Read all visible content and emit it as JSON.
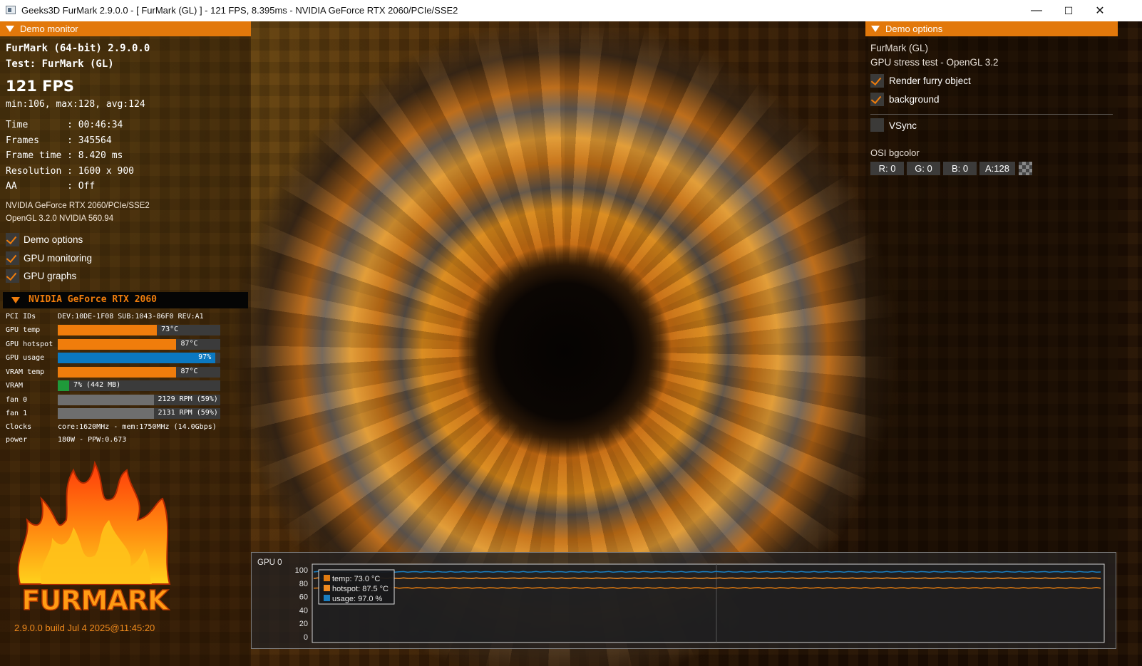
{
  "window": {
    "title": "Geeks3D FurMark 2.9.0.0 - [ FurMark (GL) ] - 121 FPS, 8.395ms - NVIDIA GeForce RTX 2060/PCIe/SSE2",
    "minimize": "—",
    "maximize": "☐",
    "close": "✕"
  },
  "demo_monitor": {
    "header": "Demo monitor",
    "app_line": "FurMark (64-bit) 2.9.0.0",
    "test_line": "Test: FurMark (GL)",
    "fps": "121 FPS",
    "fps_stats": "min:106, max:128, avg:124",
    "stats": [
      {
        "label": "Time       : 00:46:34"
      },
      {
        "label": "Frames     : 345564"
      },
      {
        "label": "Frame time : 8.420 ms"
      },
      {
        "label": "Resolution : 1600 x 900"
      },
      {
        "label": "AA         : Off"
      }
    ],
    "renderer": "NVIDIA GeForce RTX 2060/PCIe/SSE2",
    "opengl": "OpenGL 3.2.0 NVIDIA 560.94",
    "toggles": [
      {
        "label": "Demo options",
        "checked": true
      },
      {
        "label": "GPU monitoring",
        "checked": true
      },
      {
        "label": "GPU graphs",
        "checked": true
      }
    ]
  },
  "gpu": {
    "header": "NVIDIA GeForce RTX 2060",
    "pci_label": "PCI IDs",
    "pci_value": "DEV:10DE-1F08 SUB:1043-86F0 REV:A1",
    "bars": [
      {
        "label": "GPU temp",
        "text": "73°C",
        "fraction": 0.61,
        "color": "#f07d0c"
      },
      {
        "label": "GPU hotspot",
        "text": "87°C",
        "fraction": 0.73,
        "color": "#f07d0c"
      },
      {
        "label": "GPU usage",
        "text": "97%",
        "fraction": 0.97,
        "color": "#0b78c0"
      },
      {
        "label": "VRAM temp",
        "text": "87°C",
        "fraction": 0.73,
        "color": "#f07d0c"
      },
      {
        "label": "VRAM",
        "text": "7% (442 MB)",
        "fraction": 0.07,
        "color": "#1f9a3a"
      },
      {
        "label": "fan 0",
        "text": "2129 RPM (59%)",
        "fraction": 0.59,
        "color": "#6e6e6e"
      },
      {
        "label": "fan 1",
        "text": "2131 RPM (59%)",
        "fraction": 0.59,
        "color": "#6e6e6e"
      }
    ],
    "clocks_label": "Clocks",
    "clocks_value": "core:1620MHz - mem:1750MHz (14.0Gbps)",
    "power_label": "power",
    "power_value": "180W - PPW:0.673"
  },
  "logo_text": "FURMARK",
  "build": "2.9.0.0 build Jul  4 2025@11:45:20",
  "demo_options": {
    "header": "Demo options",
    "line1": "FurMark (GL)",
    "line2": "GPU stress test - OpenGL 3.2",
    "checks": [
      {
        "label": "Render furry object",
        "checked": true
      },
      {
        "label": "background",
        "checked": true
      },
      {
        "label": "VSync",
        "checked": false
      }
    ],
    "osi_label": "OSI bgcolor",
    "rgba": [
      "R: 0",
      "G: 0",
      "B: 0",
      "A:128"
    ]
  },
  "graph": {
    "label": "GPU 0",
    "ylim": [
      0,
      100
    ],
    "y_ticks": [
      "100",
      "80",
      "60",
      "40",
      "20",
      "0"
    ],
    "legend": [
      {
        "text": "temp: 73.0 °C",
        "color": "#e07a10"
      },
      {
        "text": "hotspot: 87.5 °C",
        "color": "#f08a20"
      },
      {
        "text": "usage: 97.0 %",
        "color": "#1a7ec0"
      }
    ],
    "series_values": [
      73.0,
      87.5,
      97.0
    ]
  }
}
